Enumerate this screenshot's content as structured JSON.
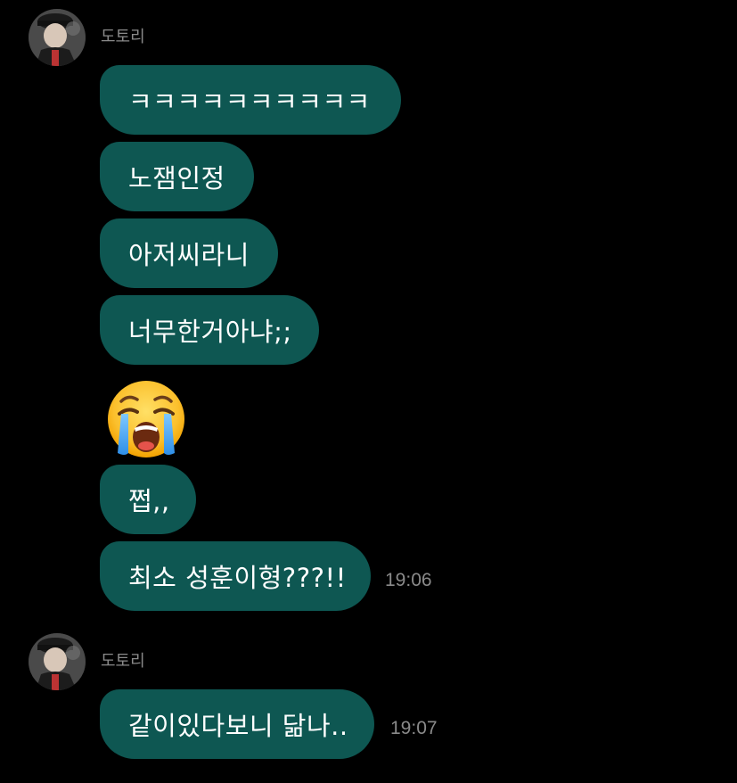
{
  "groups": [
    {
      "sender": "도토리",
      "avatar_icon": "profile-photo",
      "messages": [
        "ㅋㅋㅋㅋㅋㅋㅋㅋㅋㅋ",
        "노잼인정",
        "아저씨라니",
        "너무한거아냐;;"
      ],
      "emoji": "loudly-crying-face",
      "messages_after": [
        "쩝,,",
        "최소 성훈이형???!!"
      ],
      "time": "19:06"
    },
    {
      "sender": "도토리",
      "avatar_icon": "profile-photo",
      "messages": [
        "같이있다보니 닮나.."
      ],
      "time": "19:07"
    }
  ],
  "colors": {
    "background": "#000000",
    "bubble": "#0e5752",
    "meta_text": "#8a8a8a"
  }
}
